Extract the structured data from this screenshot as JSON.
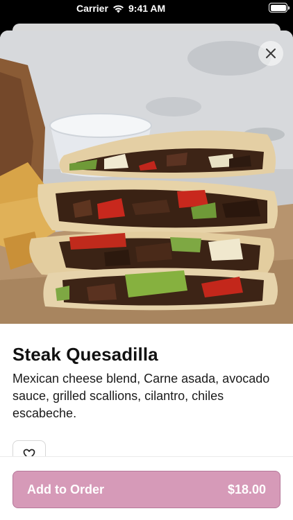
{
  "status_bar": {
    "carrier": "Carrier",
    "time": "9:41 AM",
    "wifi_icon": "wifi-icon",
    "battery_icon": "battery-icon"
  },
  "item": {
    "name": "Steak Quesadilla",
    "description": "Mexican cheese blend, Carne asada, avocado sauce, grilled scallions, cilantro, chiles escabeche.",
    "image_alt": "steak quesadilla photo"
  },
  "actions": {
    "close_icon": "close-icon",
    "favorite_icon": "heart-icon",
    "add_to_order_label": "Add to Order",
    "price": "$18.00"
  },
  "colors": {
    "accent": "#d69ab8",
    "accent_border": "#b6779a",
    "text": "#111111"
  }
}
